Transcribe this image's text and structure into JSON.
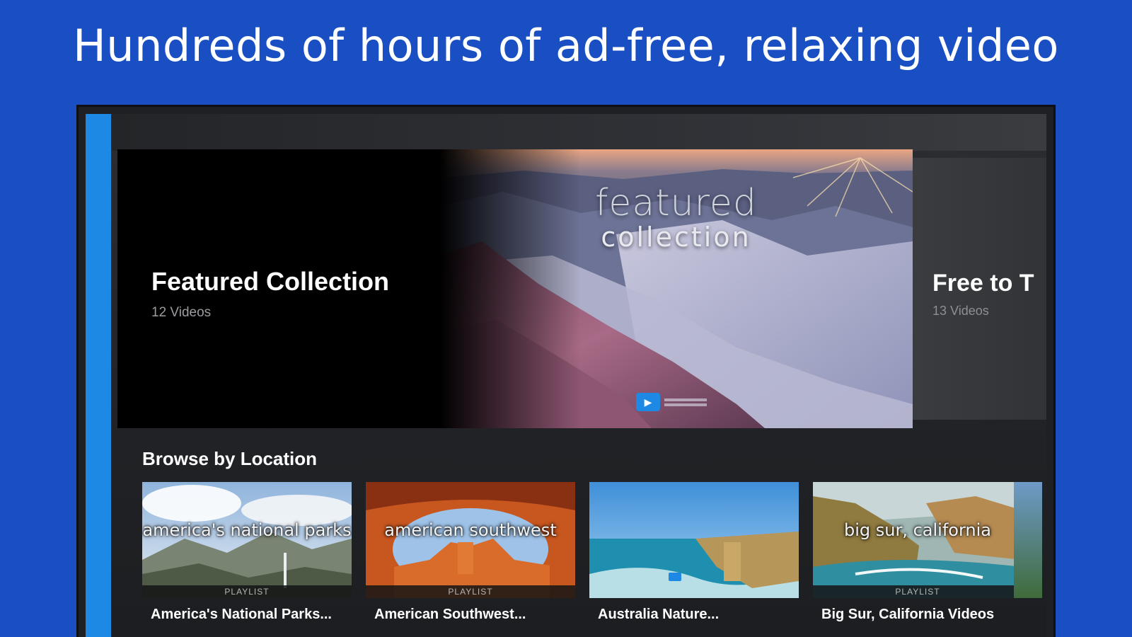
{
  "headline": "Hundreds of hours of ad-free, relaxing video",
  "colors": {
    "background": "#1a4fc4",
    "nav_rail": "#1e88e5",
    "screen": "#1f2124"
  },
  "hero": {
    "title": "Featured Collection",
    "subtitle": "12 Videos",
    "overlay_line1": "featured",
    "overlay_line2": "collection",
    "brand_icon": "play-logo-icon"
  },
  "next_hero": {
    "title": "Free to T",
    "subtitle": "13 Videos"
  },
  "browse": {
    "section_title": "Browse by Location",
    "tiles": [
      {
        "overlay": "america's national parks",
        "tag": "PLAYLIST",
        "label": "America's National Parks..."
      },
      {
        "overlay": "american southwest",
        "tag": "PLAYLIST",
        "label": "American Southwest..."
      },
      {
        "overlay": "",
        "tag": "",
        "label": "Australia Nature..."
      },
      {
        "overlay": "big sur, california",
        "tag": "PLAYLIST",
        "label": "Big Sur, California Videos"
      }
    ]
  }
}
